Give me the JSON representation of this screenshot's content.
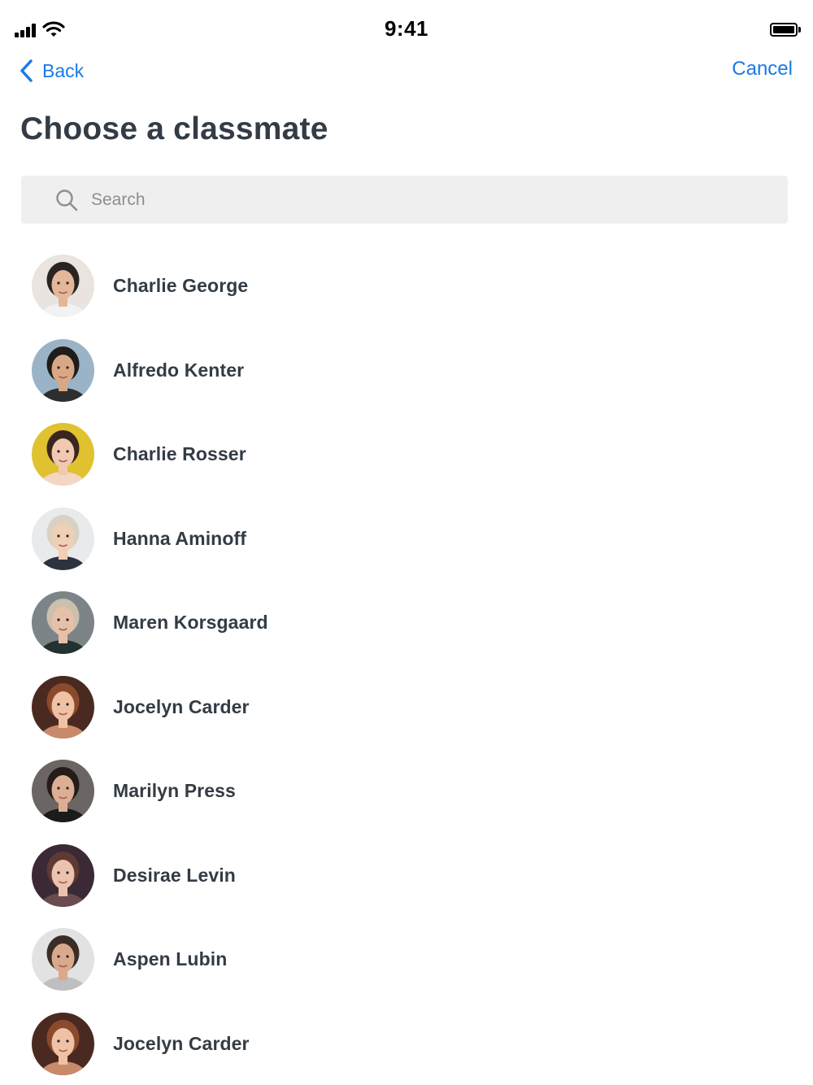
{
  "status_bar": {
    "time": "9:41",
    "icons": [
      "cellular-signal-icon",
      "wifi-icon",
      "battery-icon"
    ]
  },
  "nav": {
    "back_label": "Back",
    "cancel_label": "Cancel",
    "accent_color": "#1a7ae6"
  },
  "page": {
    "title": "Choose a classmate"
  },
  "search": {
    "placeholder": "Search",
    "value": ""
  },
  "classmates": [
    {
      "name": "Charlie George",
      "bg": "#e9e4df",
      "hair": "#2a2421",
      "skin": "#e5b79a",
      "shirt": "#f2f2f2"
    },
    {
      "name": "Alfredo Kenter",
      "bg": "#9bb3c7",
      "hair": "#1f1c1b",
      "skin": "#d8a886",
      "shirt": "#2e2e2e"
    },
    {
      "name": "Charlie Rosser",
      "bg": "#e0c12f",
      "hair": "#3a261e",
      "skin": "#f0c9b0",
      "shirt": "#f3d7c4"
    },
    {
      "name": "Hanna Aminoff",
      "bg": "#e8eaec",
      "hair": "#d9d2c1",
      "skin": "#f0cfb6",
      "shirt": "#2c3340"
    },
    {
      "name": "Maren Korsgaard",
      "bg": "#7d8488",
      "hair": "#cdbfad",
      "skin": "#e5c1a9",
      "shirt": "#233130"
    },
    {
      "name": "Jocelyn Carder",
      "bg": "#4a2a20",
      "hair": "#8c4a2c",
      "skin": "#efc1a5",
      "shirt": "#c98a6b"
    },
    {
      "name": "Marilyn Press",
      "bg": "#6b6663",
      "hair": "#241c18",
      "skin": "#dcae93",
      "shirt": "#1b1b1b"
    },
    {
      "name": "Desirae Levin",
      "bg": "#3b2a36",
      "hair": "#5d3a32",
      "skin": "#eac2ae",
      "shirt": "#6b4b4f"
    },
    {
      "name": "Aspen Lubin",
      "bg": "#e2e2e2",
      "hair": "#3a2d25",
      "skin": "#d8a98c",
      "shirt": "#bfbfbf"
    },
    {
      "name": "Jocelyn Carder",
      "bg": "#4a2a20",
      "hair": "#8c4a2c",
      "skin": "#efc1a5",
      "shirt": "#c98a6b"
    }
  ]
}
